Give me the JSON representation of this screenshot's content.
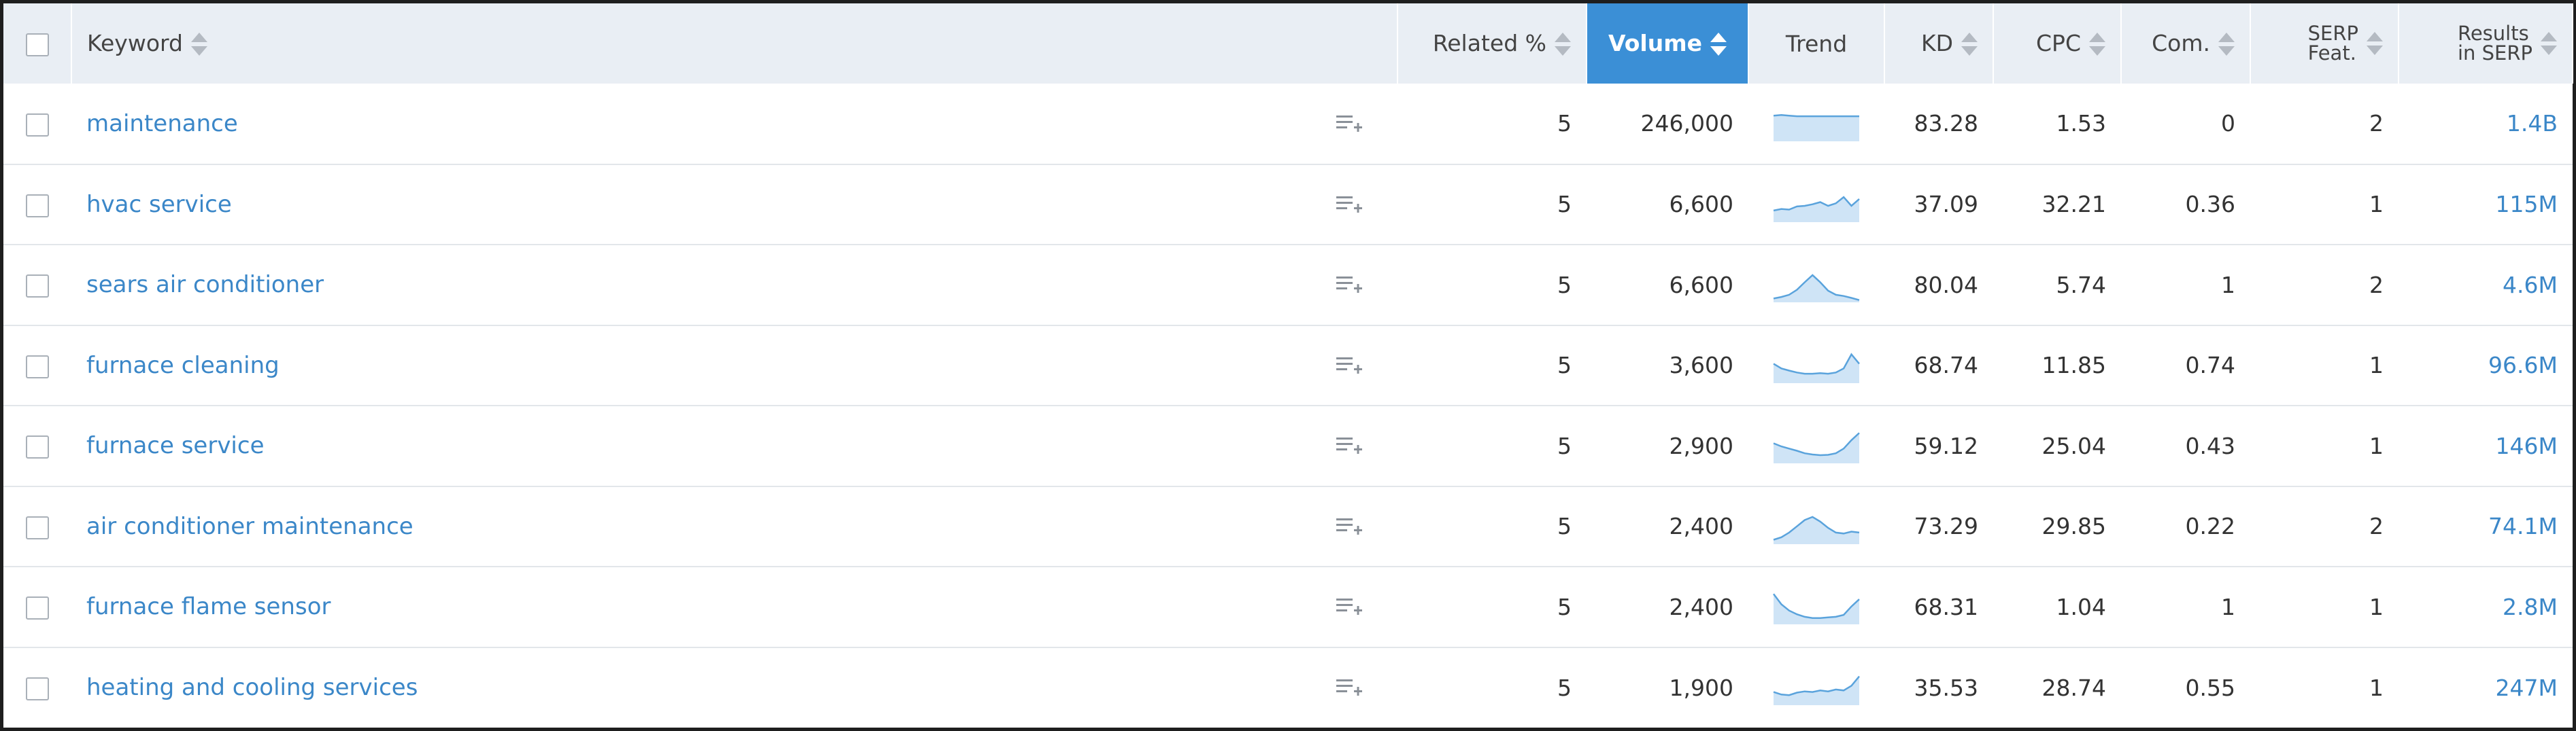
{
  "header": {
    "keyword": "Keyword",
    "related": "Related %",
    "volume": "Volume",
    "trend": "Trend",
    "kd": "KD",
    "cpc": "CPC",
    "com": "Com.",
    "serp_line1": "SERP",
    "serp_line2": "Feat.",
    "results_line1": "Results",
    "results_line2": "in SERP",
    "sorted_column": "volume"
  },
  "colors": {
    "link": "#3b87c8",
    "sorted_header": "#3b8fd6",
    "header_bg": "#e9eef4",
    "trend_fill": "#cfe4f6",
    "trend_line": "#5aa3dc"
  },
  "icons": {
    "checkbox": "checkbox",
    "add_to_list": "list-add-icon",
    "sort": "sort-arrows-icon"
  },
  "rows": [
    {
      "keyword": "maintenance",
      "related": "5",
      "volume": "246,000",
      "kd": "83.28",
      "cpc": "1.53",
      "com": "0",
      "serp": "2",
      "results": "1.4B",
      "trend": [
        0.8,
        0.82,
        0.8,
        0.78,
        0.78,
        0.78,
        0.78,
        0.78,
        0.78,
        0.78,
        0.78,
        0.78
      ]
    },
    {
      "keyword": "hvac service",
      "related": "5",
      "volume": "6,600",
      "kd": "37.09",
      "cpc": "32.21",
      "com": "0.36",
      "serp": "1",
      "results": "115M",
      "trend": [
        0.35,
        0.4,
        0.38,
        0.48,
        0.5,
        0.55,
        0.62,
        0.5,
        0.58,
        0.78,
        0.5,
        0.72
      ]
    },
    {
      "keyword": "sears air conditioner",
      "related": "5",
      "volume": "6,600",
      "kd": "80.04",
      "cpc": "5.74",
      "com": "1",
      "serp": "2",
      "results": "4.6M",
      "trend": [
        0.1,
        0.15,
        0.22,
        0.38,
        0.62,
        0.85,
        0.62,
        0.35,
        0.22,
        0.18,
        0.12,
        0.05
      ]
    },
    {
      "keyword": "furnace cleaning",
      "related": "5",
      "volume": "3,600",
      "kd": "68.74",
      "cpc": "11.85",
      "com": "0.74",
      "serp": "1",
      "results": "96.6M",
      "trend": [
        0.6,
        0.45,
        0.38,
        0.32,
        0.28,
        0.28,
        0.3,
        0.28,
        0.32,
        0.45,
        0.9,
        0.6
      ]
    },
    {
      "keyword": "furnace service",
      "related": "5",
      "volume": "2,900",
      "kd": "59.12",
      "cpc": "25.04",
      "com": "0.43",
      "serp": "1",
      "results": "146M",
      "trend": [
        0.62,
        0.52,
        0.45,
        0.38,
        0.3,
        0.26,
        0.24,
        0.25,
        0.3,
        0.45,
        0.72,
        0.95
      ]
    },
    {
      "keyword": "air conditioner maintenance",
      "related": "5",
      "volume": "2,400",
      "kd": "73.29",
      "cpc": "29.85",
      "com": "0.22",
      "serp": "2",
      "results": "74.1M",
      "trend": [
        0.12,
        0.2,
        0.35,
        0.55,
        0.75,
        0.85,
        0.7,
        0.5,
        0.35,
        0.32,
        0.38,
        0.35
      ]
    },
    {
      "keyword": "furnace flame sensor",
      "related": "5",
      "volume": "2,400",
      "kd": "68.31",
      "cpc": "1.04",
      "com": "1",
      "serp": "1",
      "results": "2.8M",
      "trend": [
        0.95,
        0.62,
        0.42,
        0.3,
        0.22,
        0.18,
        0.18,
        0.2,
        0.22,
        0.28,
        0.55,
        0.78
      ]
    },
    {
      "keyword": "heating and cooling services",
      "related": "5",
      "volume": "1,900",
      "kd": "35.53",
      "cpc": "28.74",
      "com": "0.55",
      "serp": "1",
      "results": "247M",
      "trend": [
        0.4,
        0.32,
        0.3,
        0.38,
        0.42,
        0.4,
        0.45,
        0.42,
        0.48,
        0.45,
        0.6,
        0.9
      ]
    }
  ]
}
